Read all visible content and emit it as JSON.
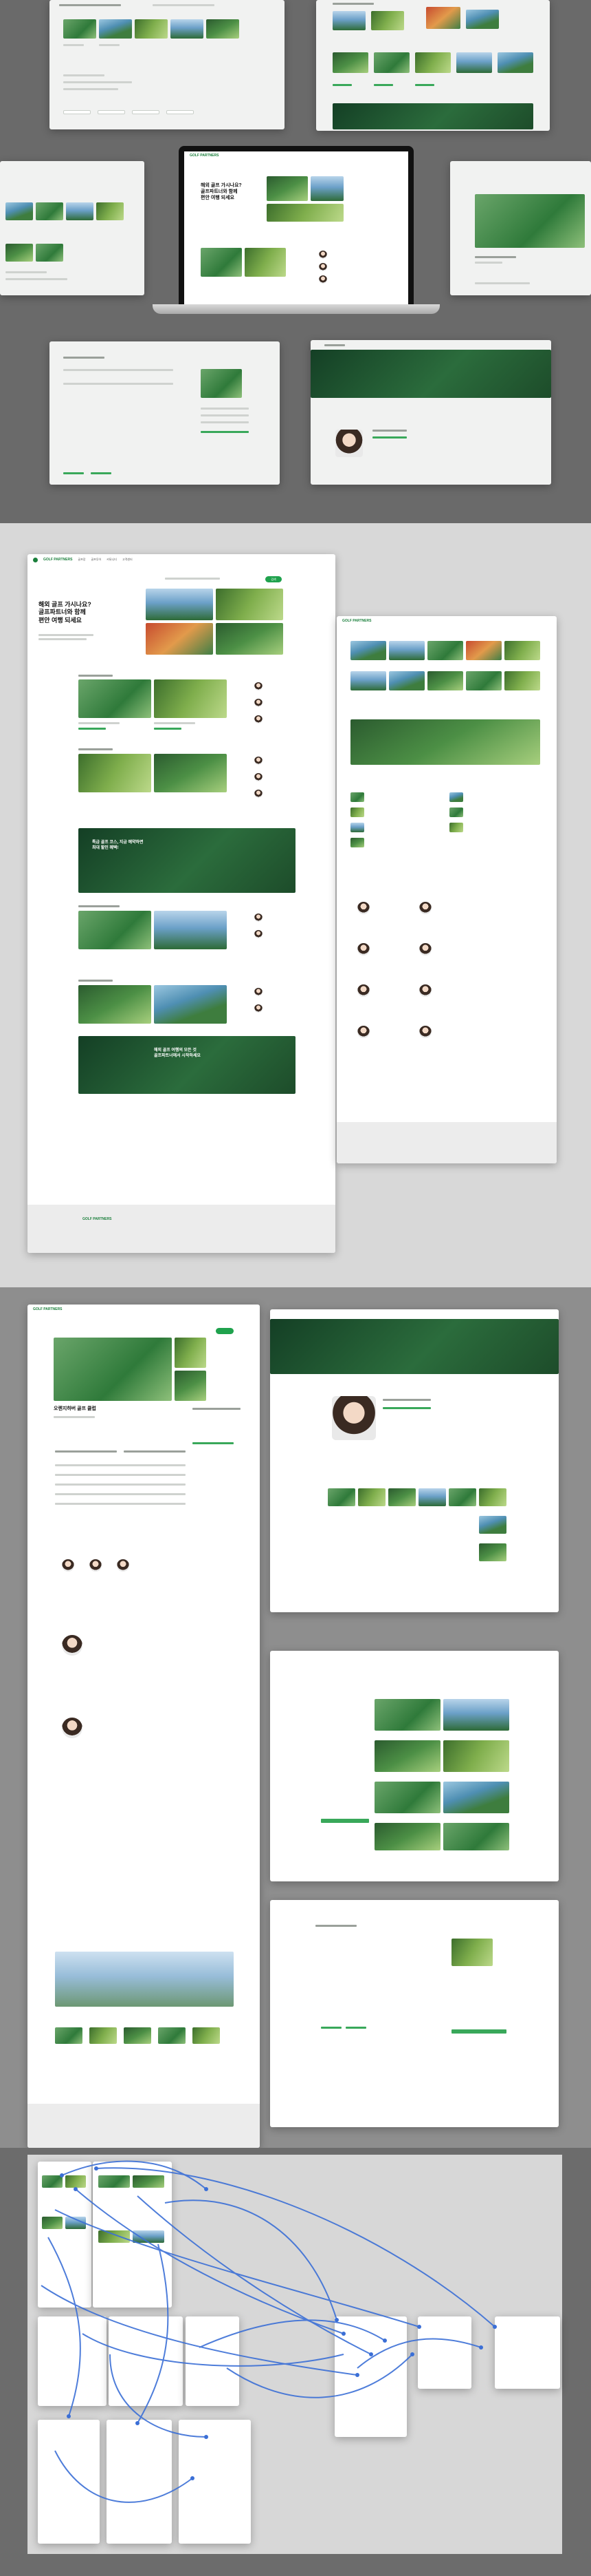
{
  "brand": {
    "logo_text": "GOLF PARTNERS",
    "accent_color": "#1fa24d",
    "dark_green": "#1a4a2a"
  },
  "home": {
    "hero_title": "해외 골프 가시나요?\n골프파트너와 함께\n편안 여행 되세요",
    "hero_title_small": "해외 골프 가시나요?\n골프파트너와 함께\n편안 여행 되세요",
    "promo_banner_1": "특급 골프 코스, 지금 예약하면\n최대 할인 혜택!",
    "promo_banner_2": "해외 골프 여행의 모든 것\n골프파트너에서 시작하세요"
  },
  "detail": {
    "page_title": "오렌지하버 골프 클럽"
  },
  "nav": {
    "items": [
      "골프장",
      "골프투어",
      "커뮤니티",
      "고객센터"
    ]
  },
  "search": {
    "button_label": "검색"
  },
  "footer": {
    "brand": "GOLF PARTNERS"
  }
}
